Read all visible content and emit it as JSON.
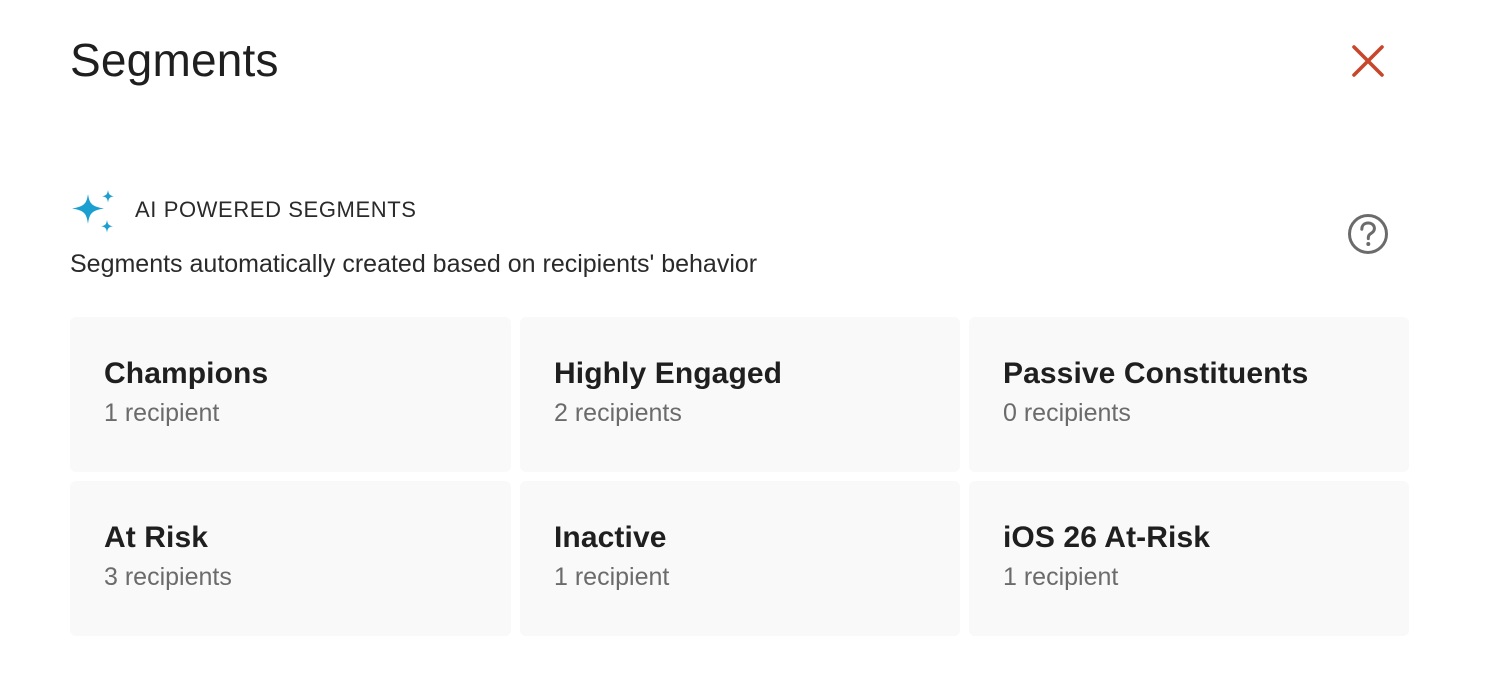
{
  "header": {
    "title": "Segments",
    "close_icon": "close-icon",
    "close_color": "#c8462b"
  },
  "ai_section": {
    "icon": "sparkle-icon",
    "icon_color": "#1b9fd0",
    "title": "AI POWERED SEGMENTS",
    "description": "Segments automatically created based on recipients' behavior",
    "help_icon": "help-icon"
  },
  "segments": [
    {
      "name": "Champions",
      "count": "1 recipient"
    },
    {
      "name": "Highly Engaged",
      "count": "2 recipients"
    },
    {
      "name": "Passive Constituents",
      "count": "0 recipients"
    },
    {
      "name": "At Risk",
      "count": "3 recipients"
    },
    {
      "name": "Inactive",
      "count": "1 recipient"
    },
    {
      "name": "iOS 26 At-Risk",
      "count": "1 recipient"
    }
  ]
}
